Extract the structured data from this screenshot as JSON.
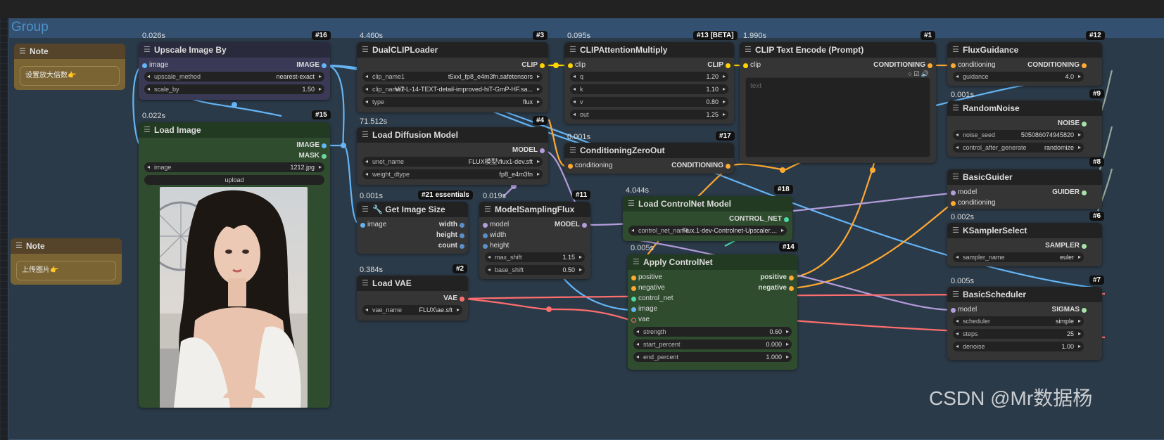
{
  "group": {
    "title": "Group"
  },
  "notes": [
    {
      "title": "Note",
      "text": "设置放大倍数👉"
    },
    {
      "title": "Note",
      "text": "上传图片👉"
    }
  ],
  "nodes": {
    "upscale": {
      "time": "0.026s",
      "id": "#16",
      "title": "Upscale Image By",
      "input": "image",
      "output": "IMAGE",
      "w1_label": "upscale_method",
      "w1_value": "nearest-exact",
      "w2_label": "scale_by",
      "w2_value": "1.50"
    },
    "loadimage": {
      "time": "0.022s",
      "id": "#15",
      "title": "Load Image",
      "out1": "IMAGE",
      "out2": "MASK",
      "w1_label": "image",
      "w1_value": "1212.jpg",
      "upload": "upload"
    },
    "dualclip": {
      "time": "4.460s",
      "id": "#3",
      "title": "DualCLIPLoader",
      "output": "CLIP",
      "w1_label": "clip_name1",
      "w1_value": "t5xxl_fp8_e4m3fn.safetensors",
      "w2_label": "clip_name2",
      "w2_value": "ViT-L-14-TEXT-detail-improved-hiT-GmP-HF.sa...",
      "w3_label": "type",
      "w3_value": "flux"
    },
    "loaddiff": {
      "time": "71.512s",
      "id": "#4",
      "title": "Load Diffusion Model",
      "output": "MODEL",
      "w1_label": "unet_name",
      "w1_value": "FLUX模型\\flux1-dev.sft",
      "w2_label": "weight_dtype",
      "w2_value": "fp8_e4m3fn"
    },
    "getsize": {
      "time": "0.001s",
      "id": "#21 essentials",
      "title": "🔧 Get Image Size",
      "input": "image",
      "out1": "width",
      "out2": "height",
      "out3": "count"
    },
    "loadvae": {
      "time": "0.384s",
      "id": "#2",
      "title": "Load VAE",
      "output": "VAE",
      "w1_label": "vae_name",
      "w1_value": "FLUX\\ae.sft"
    },
    "msflux": {
      "time": "0.019s",
      "id": "#11",
      "title": "ModelSamplingFlux",
      "in1": "model",
      "in2": "width",
      "in3": "height",
      "output": "MODEL",
      "w1_label": "max_shift",
      "w1_value": "1.15",
      "w2_label": "base_shift",
      "w2_value": "0.50"
    },
    "clipattn": {
      "time": "0.095s",
      "id": "#13 [BETA]",
      "title": "CLIPAttentionMultiply",
      "input": "clip",
      "output": "CLIP",
      "w1_label": "q",
      "w1_value": "1.20",
      "w2_label": "k",
      "w2_value": "1.10",
      "w3_label": "v",
      "w3_value": "0.80",
      "w4_label": "out",
      "w4_value": "1.25"
    },
    "condzero": {
      "time": "0.001s",
      "id": "#17",
      "title": "ConditioningZeroOut",
      "input": "conditioning",
      "output": "CONDITIONING"
    },
    "cliptext": {
      "time": "1.990s",
      "id": "#1",
      "title": "CLIP Text Encode (Prompt)",
      "input": "clip",
      "output": "CONDITIONING",
      "placeholder": "text"
    },
    "loadcn": {
      "time": "4.044s",
      "id": "#18",
      "title": "Load ControlNet Model",
      "output": "CONTROL_NET",
      "w1_label": "control_net_name",
      "w1_value": "Flux.1-dev-Controlnet-Upscaler...."
    },
    "applycn": {
      "time": "0.005s",
      "id": "#14",
      "title": "Apply ControlNet",
      "in1": "positive",
      "in2": "negative",
      "in3": "control_net",
      "in4": "image",
      "in5": "vae",
      "out1": "positive",
      "out2": "negative",
      "w1_label": "strength",
      "w1_value": "0.60",
      "w2_label": "start_percent",
      "w2_value": "0.000",
      "w3_label": "end_percent",
      "w3_value": "1.000"
    },
    "fluxguid": {
      "id": "#12",
      "title": "FluxGuidance",
      "input": "conditioning",
      "output": "CONDITIONING",
      "w1_label": "guidance",
      "w1_value": "4.0"
    },
    "randnoise": {
      "time": "0.001s",
      "id": "#9",
      "title": "RandomNoise",
      "output": "NOISE",
      "w1_label": "noise_seed",
      "w1_value": "505086074945820",
      "w2_label": "control_after_generate",
      "w2_value": "randomize"
    },
    "basicguider": {
      "id": "#8",
      "title": "BasicGuider",
      "in1": "model",
      "in2": "conditioning",
      "output": "GUIDER"
    },
    "ksampsel": {
      "time": "0.002s",
      "id": "#6",
      "title": "KSamplerSelect",
      "output": "SAMPLER",
      "w1_label": "sampler_name",
      "w1_value": "euler"
    },
    "basicsched": {
      "time": "0.005s",
      "id": "#7",
      "title": "BasicScheduler",
      "input": "model",
      "output": "SIGMAS",
      "w1_label": "scheduler",
      "w1_value": "simple",
      "w2_label": "steps",
      "w2_value": "25",
      "w3_label": "denoise",
      "w3_value": "1.00"
    }
  },
  "watermark": "CSDN @Mr数据杨",
  "colors": {
    "image": "#64b5f6",
    "clip": "#ffd500",
    "conditioning": "#ffa931",
    "model": "#b39ddb",
    "vae": "#ff6e6e",
    "control_net": "#00d78d",
    "noise": "#b0b0b0",
    "group": "#335070"
  }
}
